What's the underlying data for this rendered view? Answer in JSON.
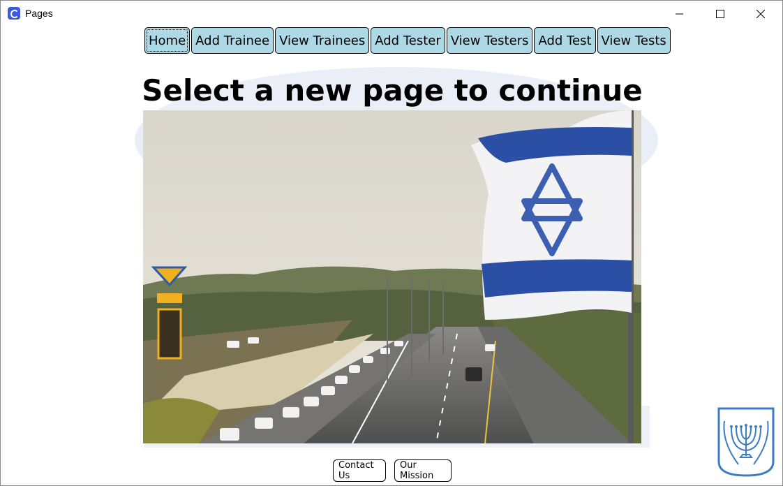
{
  "window": {
    "title": "Pages",
    "app_icon": "app-icon",
    "controls": {
      "minimize": "minimize-icon",
      "maximize": "maximize-icon",
      "close": "close-icon"
    }
  },
  "nav": {
    "items": [
      {
        "label": "Home",
        "active": true
      },
      {
        "label": "Add Trainee",
        "active": false
      },
      {
        "label": "View Trainees",
        "active": false
      },
      {
        "label": "Add Tester",
        "active": false
      },
      {
        "label": "View Testers",
        "active": false
      },
      {
        "label": "Add Test",
        "active": false
      },
      {
        "label": "View Tests",
        "active": false
      }
    ],
    "color": "#add8e6"
  },
  "main": {
    "heading": "Select a new page to continue",
    "image": "highway-with-israeli-flag"
  },
  "footer": {
    "contact_label": "Contact Us",
    "mission_label": "Our Mission"
  },
  "emblem": {
    "icon": "menorah-emblem-icon",
    "color": "#3b7dc4"
  }
}
